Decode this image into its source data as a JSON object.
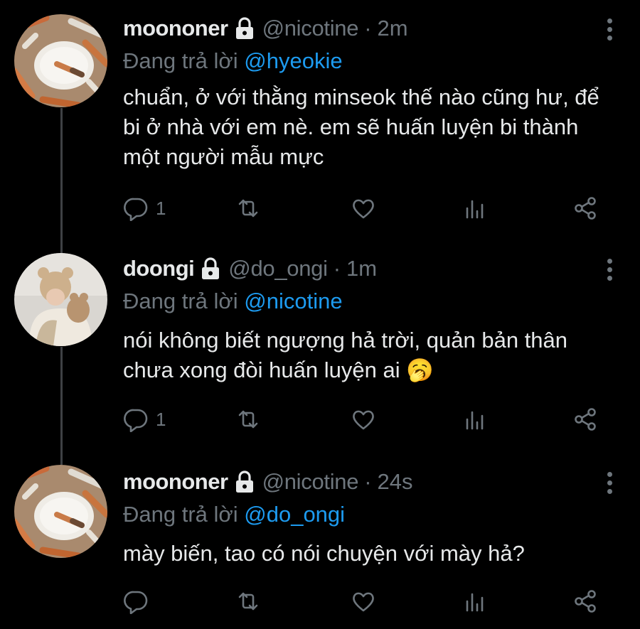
{
  "tweets": [
    {
      "name": "moononer",
      "handle": "@nicotine",
      "sep": "·",
      "time": "2m",
      "reply_prefix": "Đang trả lời",
      "reply_mention": "@hyeokie",
      "text": "chuẩn, ở với thằng minseok thế nào cũng hư, để bi ở nhà với em nè. em sẽ huấn luyện bi thành một người mẫu mực",
      "reply_count": "1",
      "avatar": "cigarette-ashtray-photo"
    },
    {
      "name": "doongi",
      "handle": "@do_ongi",
      "sep": "·",
      "time": "1m",
      "reply_prefix": "Đang trả lời",
      "reply_mention": "@nicotine",
      "text": "nói không biết ngượng hả trời, quản bản thân chưa xong đòi huấn luyện ai",
      "emoji": "🥱",
      "reply_count": "1",
      "avatar": "person-with-bear-hat-photo"
    },
    {
      "name": "moononer",
      "handle": "@nicotine",
      "sep": "·",
      "time": "24s",
      "reply_prefix": "Đang trả lời",
      "reply_mention": "@do_ongi",
      "text": "mày biến, tao có nói chuyện với mày hả?",
      "reply_count": "",
      "avatar": "cigarette-ashtray-photo"
    }
  ],
  "icons": [
    "reply-icon",
    "retweet-icon",
    "like-icon",
    "stats-icon",
    "share-icon",
    "lock-icon",
    "more-icon"
  ],
  "colors": {
    "background": "#000000",
    "text": "#e7e9ea",
    "muted": "#6e767d",
    "link": "#1d9bf0"
  }
}
